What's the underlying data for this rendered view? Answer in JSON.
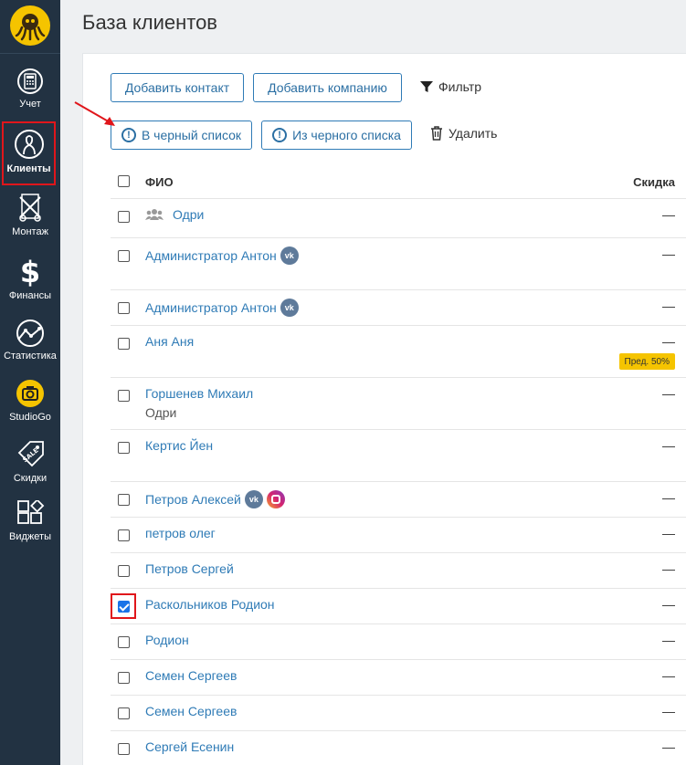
{
  "sidebar": {
    "items": [
      {
        "label": "Учет",
        "icon": "calculator-icon"
      },
      {
        "label": "Клиенты",
        "icon": "client-icon",
        "active": true
      },
      {
        "label": "Монтаж",
        "icon": "film-scissors-icon"
      },
      {
        "label": "Финансы",
        "icon": "dollar-icon"
      },
      {
        "label": "Статистика",
        "icon": "chart-line-icon"
      },
      {
        "label": "StudioGo",
        "icon": "camera-icon"
      },
      {
        "label": "Скидки",
        "icon": "sale-tag-icon"
      },
      {
        "label": "Виджеты",
        "icon": "widgets-icon"
      }
    ]
  },
  "header": {
    "title": "База клиентов"
  },
  "toolbar": {
    "add_contact": "Добавить контакт",
    "add_company": "Добавить компанию",
    "filter": "Фильтр",
    "to_blacklist": "В черный список",
    "from_blacklist": "Из черного списка",
    "delete": "Удалить"
  },
  "table": {
    "col_name": "ФИО",
    "col_discount": "Скидка",
    "rows": [
      {
        "name": "Одри",
        "sub": "",
        "discount": "—",
        "group": true
      },
      {
        "name": "Администратор Антон",
        "sub": "",
        "discount": "—",
        "vk": true
      },
      {
        "name": "Администратор Антон",
        "sub": "",
        "discount": "—",
        "vk": true
      },
      {
        "name": "Аня Аня",
        "sub": "",
        "discount": "—",
        "badge": "Пред. 50%"
      },
      {
        "name": "Горшенев Михаил",
        "sub": "Одри",
        "discount": "—"
      },
      {
        "name": "Кертис Йен",
        "sub": "",
        "discount": "—"
      },
      {
        "name": "Петров Алексей",
        "sub": "",
        "discount": "—",
        "vk": true,
        "ig": true
      },
      {
        "name": "петров олег",
        "sub": "",
        "discount": "—"
      },
      {
        "name": "Петров Сергей",
        "sub": "",
        "discount": "—"
      },
      {
        "name": "Раскольников Родион",
        "sub": "",
        "discount": "—",
        "checked": true
      },
      {
        "name": "Родион",
        "sub": "",
        "discount": "—"
      },
      {
        "name": "Семен Сергеев",
        "sub": "",
        "discount": "—"
      },
      {
        "name": "Семен Сергеев",
        "sub": "",
        "discount": "—"
      },
      {
        "name": "Сергей Есенин",
        "sub": "",
        "discount": "—"
      }
    ]
  },
  "colors": {
    "accent": "#2f7bb6",
    "sidebar": "#223242",
    "highlight": "#e0161b",
    "badge": "#f5c400"
  }
}
